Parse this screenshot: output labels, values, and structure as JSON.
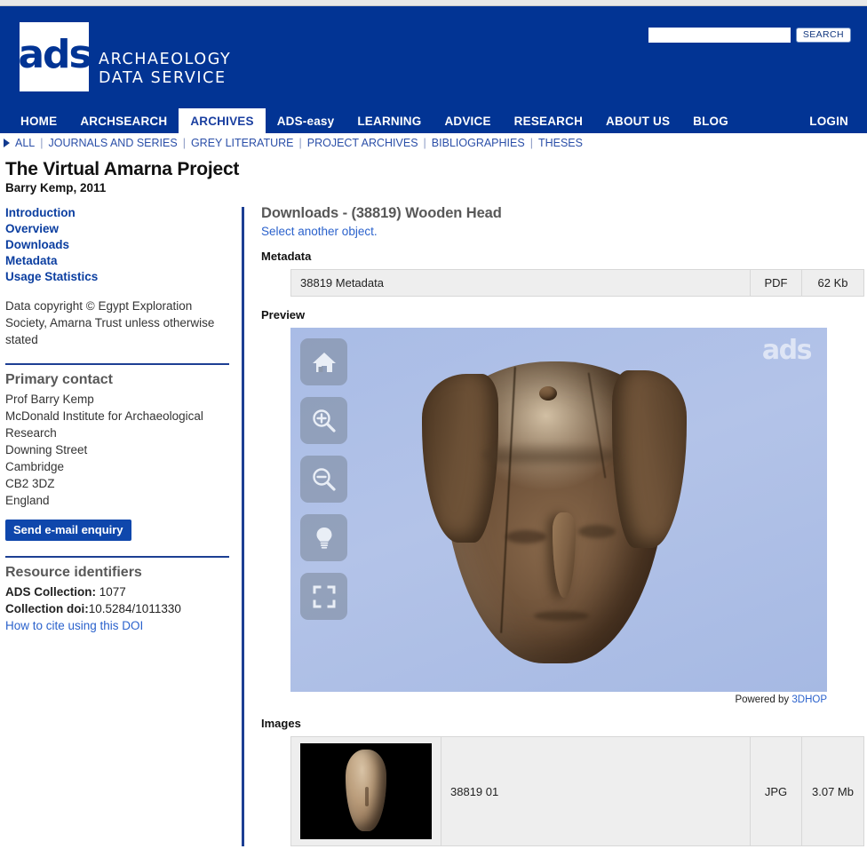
{
  "brand": {
    "logo_text": "ads",
    "logo_line1": "ARCHAEOLOGY",
    "logo_line2": "DATA SERVICE"
  },
  "search": {
    "value": "",
    "placeholder": "",
    "button_label": "SEARCH"
  },
  "nav_primary": {
    "items": [
      {
        "label": "HOME",
        "active": false
      },
      {
        "label": "ARCHSEARCH",
        "active": false
      },
      {
        "label": "ARCHIVES",
        "active": true
      },
      {
        "label": "ADS-easy",
        "active": false
      },
      {
        "label": "LEARNING",
        "active": false
      },
      {
        "label": "ADVICE",
        "active": false
      },
      {
        "label": "RESEARCH",
        "active": false
      },
      {
        "label": "ABOUT US",
        "active": false
      },
      {
        "label": "BLOG",
        "active": false
      }
    ],
    "login_label": "LOGIN"
  },
  "nav_secondary": {
    "items": [
      "ALL",
      "JOURNALS AND SERIES",
      "GREY LITERATURE",
      "PROJECT ARCHIVES",
      "BIBLIOGRAPHIES",
      "THESES"
    ]
  },
  "page": {
    "title": "The Virtual Amarna Project",
    "subtitle": "Barry Kemp, 2011"
  },
  "sidebar": {
    "links": [
      "Introduction",
      "Overview",
      "Downloads",
      "Metadata",
      "Usage Statistics"
    ],
    "copyright": "Data copyright © Egypt Exploration Society, Amarna Trust unless otherwise stated",
    "contact": {
      "heading": "Primary contact",
      "lines": [
        "Prof Barry Kemp",
        "McDonald Institute for Archaeological Research",
        "Downing Street",
        "Cambridge",
        "CB2 3DZ",
        "England"
      ],
      "button_label": "Send e-mail enquiry"
    },
    "identifiers": {
      "heading": "Resource identifiers",
      "collection_label": "ADS Collection:",
      "collection_value": "1077",
      "doi_label": "Collection doi:",
      "doi_value": "10.5284/1011330",
      "cite_link": "How to cite using this DOI"
    }
  },
  "content": {
    "heading": "Downloads - (38819) Wooden Head",
    "subheading": "Select another object.",
    "metadata_label": "Metadata",
    "metadata_rows": [
      {
        "name": "38819 Metadata",
        "type": "PDF",
        "size": "62 Kb"
      }
    ],
    "preview_label": "Preview",
    "viewer": {
      "watermark": "ads",
      "tools": [
        {
          "name": "home-icon",
          "title": "Home"
        },
        {
          "name": "zoom-in-icon",
          "title": "Zoom in"
        },
        {
          "name": "zoom-out-icon",
          "title": "Zoom out"
        },
        {
          "name": "lightbulb-icon",
          "title": "Lighting"
        },
        {
          "name": "fullscreen-icon",
          "title": "Full screen"
        }
      ],
      "powered_prefix": "Powered by ",
      "powered_link": "3DHOP"
    },
    "images_label": "Images",
    "image_rows": [
      {
        "name": "38819 01",
        "type": "JPG",
        "size": "3.07 Mb"
      }
    ]
  },
  "colors": {
    "brand_blue": "#023494",
    "link_blue": "#2b62cc",
    "sidebar_link": "#0b3ea0",
    "rule_blue": "#1d3f93",
    "table_bg": "#eeeeee"
  }
}
